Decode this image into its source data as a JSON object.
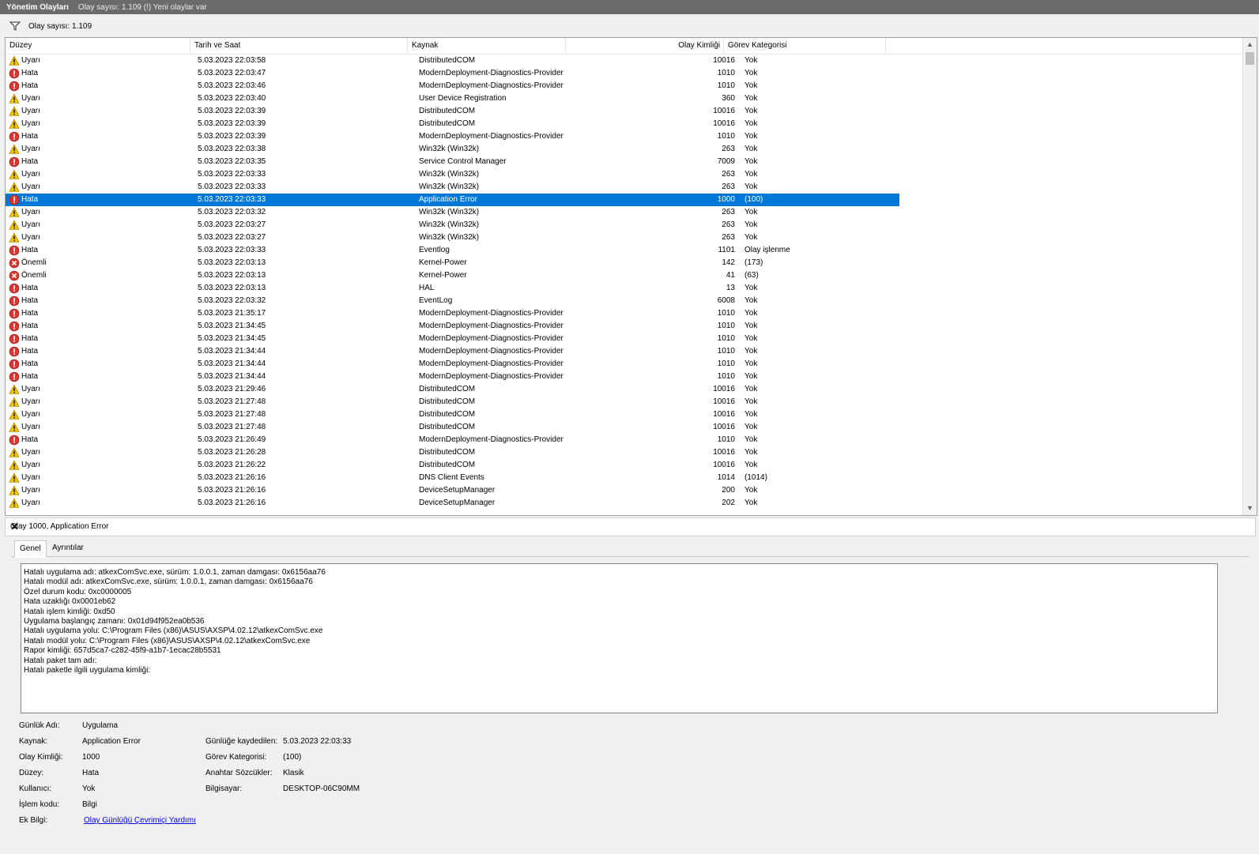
{
  "titlebar": {
    "title": "Yönetim Olayları",
    "info": "Olay sayısı: 1.109 (!) Yeni olaylar var"
  },
  "filterbar": {
    "count": "Olay sayısı: 1.109"
  },
  "columns": {
    "level": "Düzey",
    "datetime": "Tarih ve Saat",
    "source": "Kaynak",
    "event_id": "Olay Kimliği",
    "category": "Görev Kategorisi"
  },
  "colors": {
    "selection": "#0078d7",
    "warning": "#f5c400",
    "error": "#d9342b",
    "critical": "#d9342b"
  },
  "events": [
    {
      "type": "warning",
      "level": "Uyarı",
      "datetime": "5.03.2023 22:03:58",
      "source": "DistributedCOM",
      "id": "10016",
      "category": "Yok"
    },
    {
      "type": "error",
      "level": "Hata",
      "datetime": "5.03.2023 22:03:47",
      "source": "ModernDeployment-Diagnostics-Provider",
      "id": "1010",
      "category": "Yok"
    },
    {
      "type": "error",
      "level": "Hata",
      "datetime": "5.03.2023 22:03:46",
      "source": "ModernDeployment-Diagnostics-Provider",
      "id": "1010",
      "category": "Yok"
    },
    {
      "type": "warning",
      "level": "Uyarı",
      "datetime": "5.03.2023 22:03:40",
      "source": "User Device Registration",
      "id": "360",
      "category": "Yok"
    },
    {
      "type": "warning",
      "level": "Uyarı",
      "datetime": "5.03.2023 22:03:39",
      "source": "DistributedCOM",
      "id": "10016",
      "category": "Yok"
    },
    {
      "type": "warning",
      "level": "Uyarı",
      "datetime": "5.03.2023 22:03:39",
      "source": "DistributedCOM",
      "id": "10016",
      "category": "Yok"
    },
    {
      "type": "error",
      "level": "Hata",
      "datetime": "5.03.2023 22:03:39",
      "source": "ModernDeployment-Diagnostics-Provider",
      "id": "1010",
      "category": "Yok"
    },
    {
      "type": "warning",
      "level": "Uyarı",
      "datetime": "5.03.2023 22:03:38",
      "source": "Win32k (Win32k)",
      "id": "263",
      "category": "Yok"
    },
    {
      "type": "error",
      "level": "Hata",
      "datetime": "5.03.2023 22:03:35",
      "source": "Service Control Manager",
      "id": "7009",
      "category": "Yok"
    },
    {
      "type": "warning",
      "level": "Uyarı",
      "datetime": "5.03.2023 22:03:33",
      "source": "Win32k (Win32k)",
      "id": "263",
      "category": "Yok"
    },
    {
      "type": "warning",
      "level": "Uyarı",
      "datetime": "5.03.2023 22:03:33",
      "source": "Win32k (Win32k)",
      "id": "263",
      "category": "Yok"
    },
    {
      "type": "error",
      "level": "Hata",
      "datetime": "5.03.2023 22:03:33",
      "source": "Application Error",
      "id": "1000",
      "category": "(100)",
      "selected": true
    },
    {
      "type": "warning",
      "level": "Uyarı",
      "datetime": "5.03.2023 22:03:32",
      "source": "Win32k (Win32k)",
      "id": "263",
      "category": "Yok"
    },
    {
      "type": "warning",
      "level": "Uyarı",
      "datetime": "5.03.2023 22:03:27",
      "source": "Win32k (Win32k)",
      "id": "263",
      "category": "Yok"
    },
    {
      "type": "warning",
      "level": "Uyarı",
      "datetime": "5.03.2023 22:03:27",
      "source": "Win32k (Win32k)",
      "id": "263",
      "category": "Yok"
    },
    {
      "type": "error",
      "level": "Hata",
      "datetime": "5.03.2023 22:03:33",
      "source": "Eventlog",
      "id": "1101",
      "category": "Olay işlenme"
    },
    {
      "type": "critical",
      "level": "Önemli",
      "datetime": "5.03.2023 22:03:13",
      "source": "Kernel-Power",
      "id": "142",
      "category": "(173)"
    },
    {
      "type": "critical",
      "level": "Önemli",
      "datetime": "5.03.2023 22:03:13",
      "source": "Kernel-Power",
      "id": "41",
      "category": "(63)"
    },
    {
      "type": "error",
      "level": "Hata",
      "datetime": "5.03.2023 22:03:13",
      "source": "HAL",
      "id": "13",
      "category": "Yok"
    },
    {
      "type": "error",
      "level": "Hata",
      "datetime": "5.03.2023 22:03:32",
      "source": "EventLog",
      "id": "6008",
      "category": "Yok"
    },
    {
      "type": "error",
      "level": "Hata",
      "datetime": "5.03.2023 21:35:17",
      "source": "ModernDeployment-Diagnostics-Provider",
      "id": "1010",
      "category": "Yok"
    },
    {
      "type": "error",
      "level": "Hata",
      "datetime": "5.03.2023 21:34:45",
      "source": "ModernDeployment-Diagnostics-Provider",
      "id": "1010",
      "category": "Yok"
    },
    {
      "type": "error",
      "level": "Hata",
      "datetime": "5.03.2023 21:34:45",
      "source": "ModernDeployment-Diagnostics-Provider",
      "id": "1010",
      "category": "Yok"
    },
    {
      "type": "error",
      "level": "Hata",
      "datetime": "5.03.2023 21:34:44",
      "source": "ModernDeployment-Diagnostics-Provider",
      "id": "1010",
      "category": "Yok"
    },
    {
      "type": "error",
      "level": "Hata",
      "datetime": "5.03.2023 21:34:44",
      "source": "ModernDeployment-Diagnostics-Provider",
      "id": "1010",
      "category": "Yok"
    },
    {
      "type": "error",
      "level": "Hata",
      "datetime": "5.03.2023 21:34:44",
      "source": "ModernDeployment-Diagnostics-Provider",
      "id": "1010",
      "category": "Yok"
    },
    {
      "type": "warning",
      "level": "Uyarı",
      "datetime": "5.03.2023 21:29:46",
      "source": "DistributedCOM",
      "id": "10016",
      "category": "Yok"
    },
    {
      "type": "warning",
      "level": "Uyarı",
      "datetime": "5.03.2023 21:27:48",
      "source": "DistributedCOM",
      "id": "10016",
      "category": "Yok"
    },
    {
      "type": "warning",
      "level": "Uyarı",
      "datetime": "5.03.2023 21:27:48",
      "source": "DistributedCOM",
      "id": "10016",
      "category": "Yok"
    },
    {
      "type": "warning",
      "level": "Uyarı",
      "datetime": "5.03.2023 21:27:48",
      "source": "DistributedCOM",
      "id": "10016",
      "category": "Yok"
    },
    {
      "type": "error",
      "level": "Hata",
      "datetime": "5.03.2023 21:26:49",
      "source": "ModernDeployment-Diagnostics-Provider",
      "id": "1010",
      "category": "Yok"
    },
    {
      "type": "warning",
      "level": "Uyarı",
      "datetime": "5.03.2023 21:26:28",
      "source": "DistributedCOM",
      "id": "10016",
      "category": "Yok"
    },
    {
      "type": "warning",
      "level": "Uyarı",
      "datetime": "5.03.2023 21:26:22",
      "source": "DistributedCOM",
      "id": "10016",
      "category": "Yok"
    },
    {
      "type": "warning",
      "level": "Uyarı",
      "datetime": "5.03.2023 21:26:16",
      "source": "DNS Client Events",
      "id": "1014",
      "category": "(1014)"
    },
    {
      "type": "warning",
      "level": "Uyarı",
      "datetime": "5.03.2023 21:26:16",
      "source": "DeviceSetupManager",
      "id": "200",
      "category": "Yok"
    },
    {
      "type": "warning",
      "level": "Uyarı",
      "datetime": "5.03.2023 21:26:16",
      "source": "DeviceSetupManager",
      "id": "202",
      "category": "Yok"
    }
  ],
  "detail": {
    "title": "Olay 1000, Application Error",
    "tabs": [
      "Genel",
      "Ayrıntılar"
    ],
    "description": [
      "Hatalı uygulama adı: atkexComSvc.exe, sürüm: 1.0.0.1, zaman damgası: 0x6156aa76",
      "Hatalı modül adı: atkexComSvc.exe, sürüm: 1.0.0.1, zaman damgası: 0x6156aa76",
      "Özel durum kodu: 0xc0000005",
      "Hata uzaklığı 0x0001eb62",
      "Hatalı işlem kimliği: 0xd50",
      "Uygulama başlangıç zamanı: 0x01d94f952ea0b536",
      "Hatalı uygulama yolu: C:\\Program Files (x86)\\ASUS\\AXSP\\4.02.12\\atkexComSvc.exe",
      "Hatalı modül yolu: C:\\Program Files (x86)\\ASUS\\AXSP\\4.02.12\\atkexComSvc.exe",
      "Rapor kimliği: 657d5ca7-c282-45f9-a1b7-1ecac28b5531",
      "Hatalı paket tam adı:",
      "Hatalı paketle ilgili uygulama kimliği:"
    ],
    "props": {
      "log_name_label": "Günlük Adı:",
      "log_name": "Uygulama",
      "source_label": "Kaynak:",
      "source": "Application Error",
      "logged_label": "Günlüğe kaydedilen:",
      "logged": "5.03.2023 22:03:33",
      "event_id_label": "Olay Kimliği:",
      "event_id": "1000",
      "task_cat_label": "Görev Kategorisi:",
      "task_cat": "(100)",
      "level_label": "Düzey:",
      "level": "Hata",
      "keywords_label": "Anahtar Sözcükler:",
      "keywords": "Klasik",
      "user_label": "Kullanıcı:",
      "user": "Yok",
      "computer_label": "Bilgisayar:",
      "computer": "DESKTOP-06C90MM",
      "opcode_label": "İşlem kodu:",
      "opcode": "Bilgi",
      "more_info_label": "Ek Bilgi:",
      "more_info_link": "Olay Günlüğü Çevrimiçi Yardımı"
    }
  }
}
